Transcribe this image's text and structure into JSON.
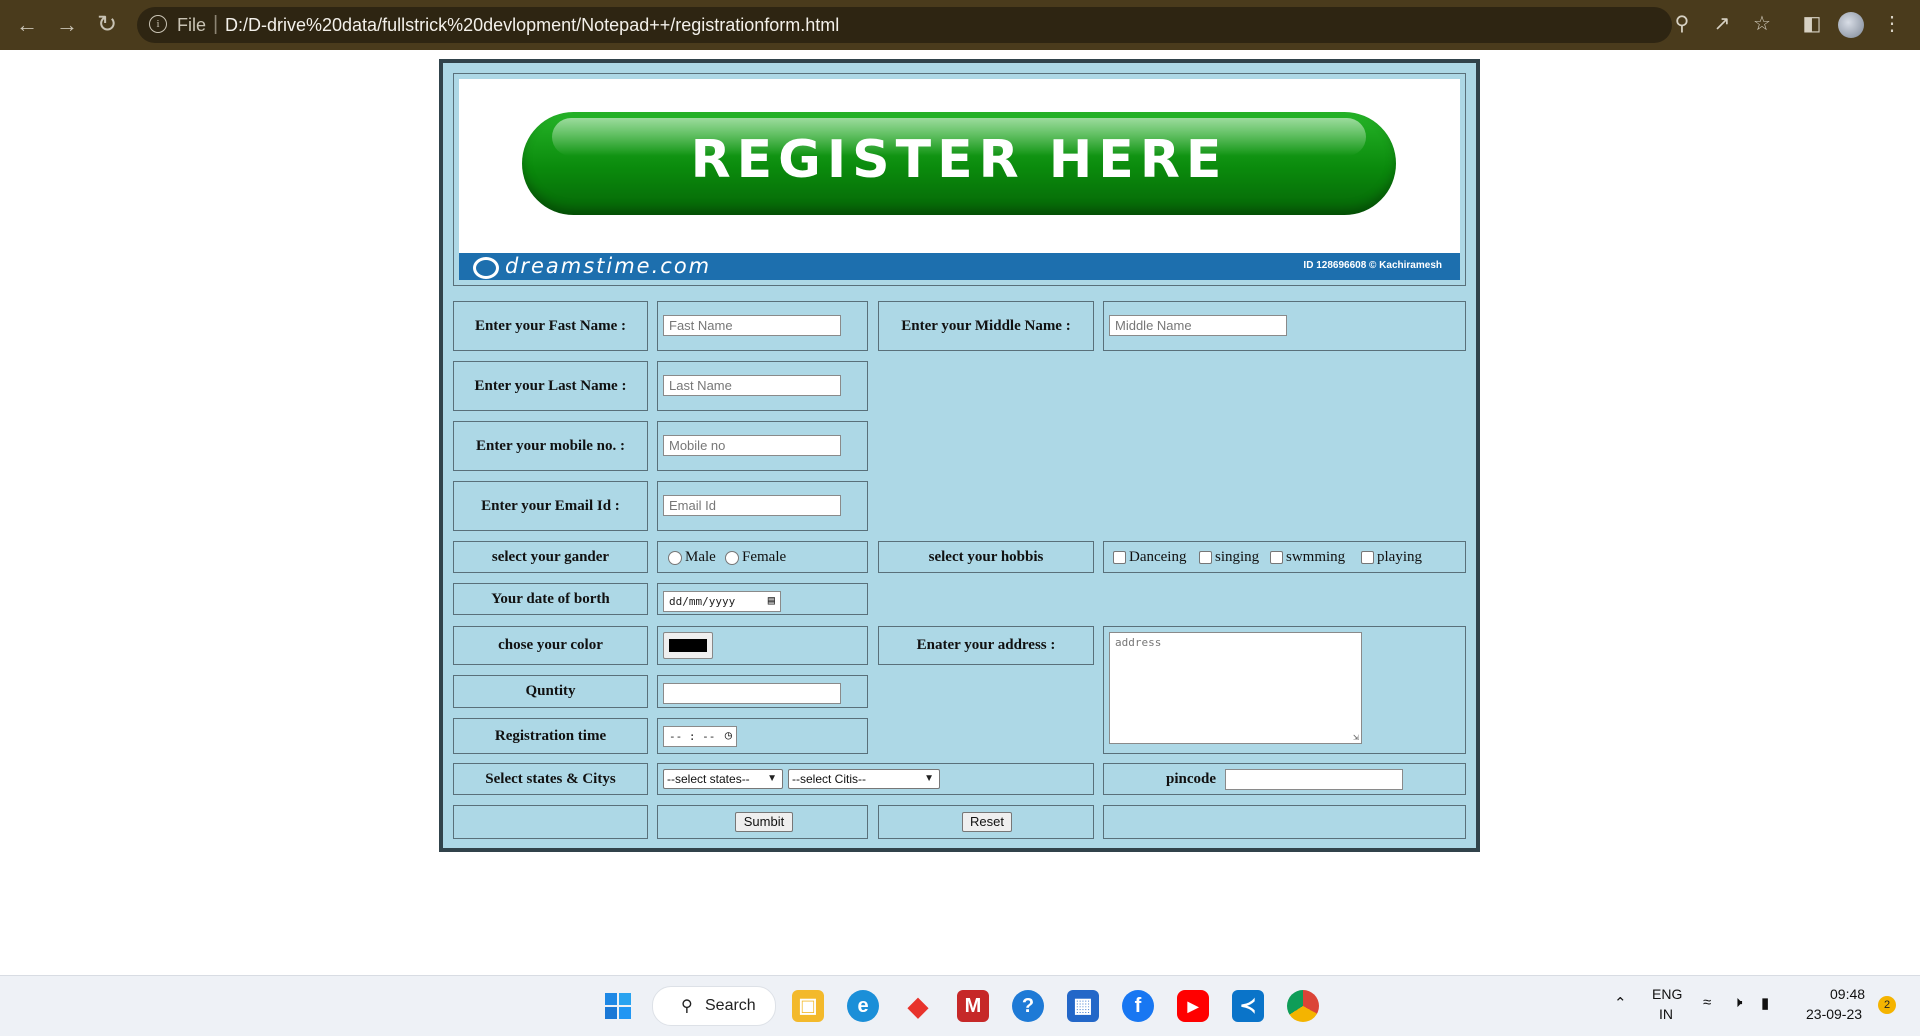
{
  "browser": {
    "file_label": "File",
    "url": "D:/D-drive%20data/fullstrick%20devlopment/Notepad++/registrationform.html"
  },
  "banner": {
    "title": "REGISTER HERE",
    "logo_text": "dreamstime.com",
    "id_text": "ID 128696608 © Kachiramesh"
  },
  "form": {
    "first_name": {
      "label": "Enter your Fast Name :",
      "placeholder": "Fast Name"
    },
    "middle_name": {
      "label": "Enter your Middle Name :",
      "placeholder": "Middle Name"
    },
    "last_name": {
      "label": "Enter your Last Name :",
      "placeholder": "Last Name"
    },
    "mobile": {
      "label": "Enter your mobile no. :",
      "placeholder": "Mobile no"
    },
    "email": {
      "label": "Enter your Email Id :",
      "placeholder": "Email Id"
    },
    "gender": {
      "label": "select your gander",
      "options": [
        "Male",
        "Female"
      ]
    },
    "hobbies": {
      "label": "select your hobbis",
      "options": [
        "Danceing",
        "singing",
        "swmming",
        "playing"
      ]
    },
    "dob": {
      "label": "Your date of borth",
      "value": "dd/mm/yyyy"
    },
    "color": {
      "label": "chose your color",
      "value": "#000000"
    },
    "address": {
      "label": "Enater your address :",
      "placeholder": "address"
    },
    "quantity": {
      "label": "Quntity",
      "value": ""
    },
    "reg_time": {
      "label": "Registration time",
      "value": "-- : --"
    },
    "states": {
      "label": "Select states & Citys",
      "state_selected": "--select states--",
      "city_selected": "--select Citis--"
    },
    "pincode": {
      "label": "pincode",
      "value": ""
    },
    "submit_label": "Sumbit",
    "reset_label": "Reset"
  },
  "taskbar": {
    "search_label": "Search",
    "lang": "ENG",
    "region": "IN",
    "time": "09:48",
    "date": "23-09-23",
    "notification_count": "2"
  }
}
